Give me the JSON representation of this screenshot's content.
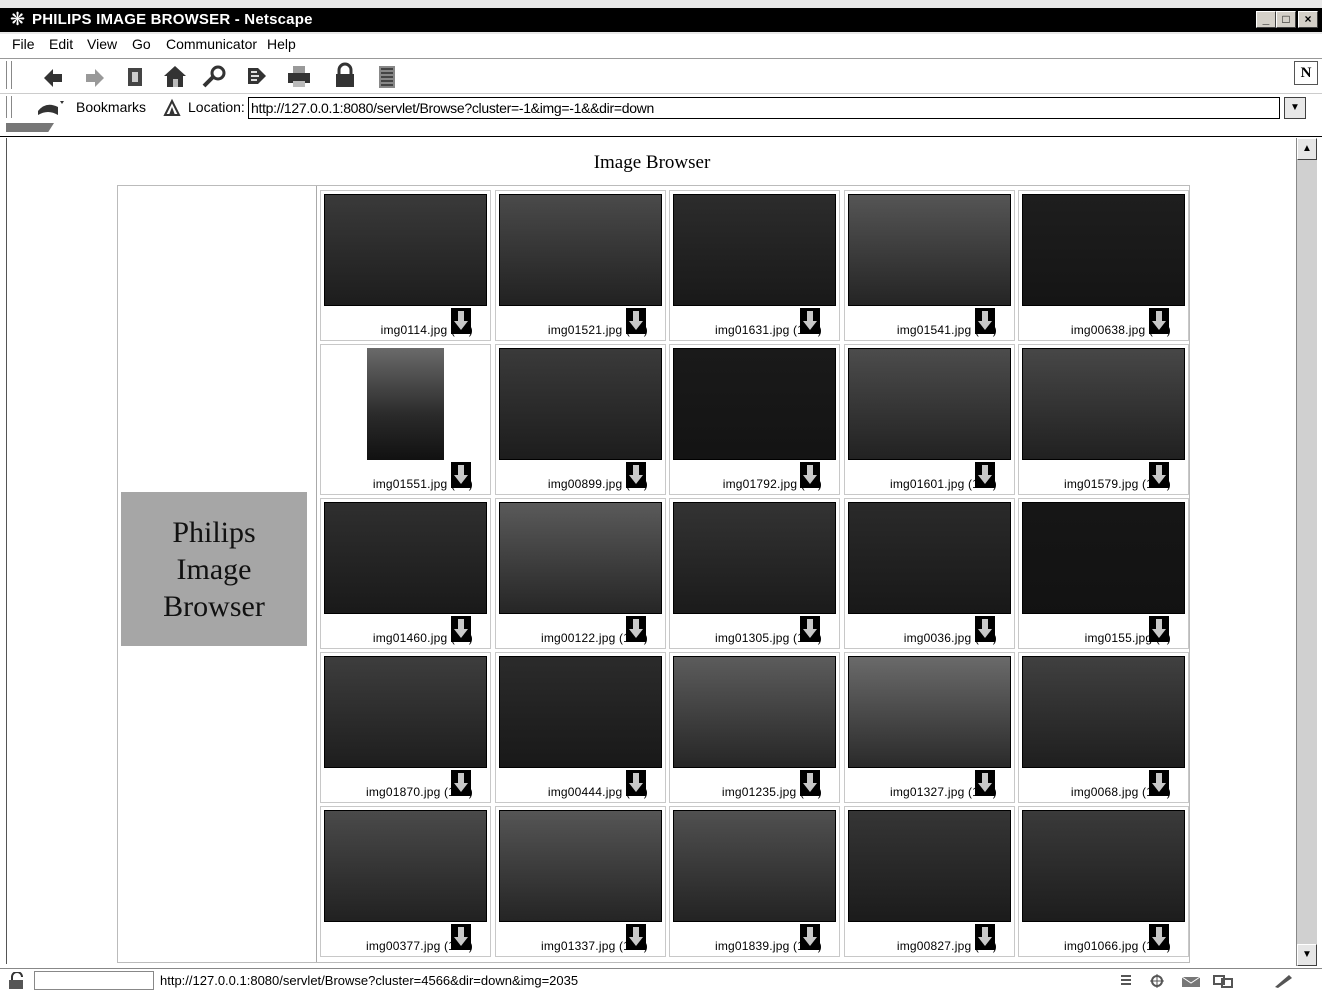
{
  "window": {
    "title": "PHILIPS IMAGE BROWSER - Netscape"
  },
  "menubar": {
    "items": [
      "File",
      "Edit",
      "View",
      "Go",
      "Communicator",
      "Help"
    ]
  },
  "toolbar": {
    "buttons": [
      "back-icon",
      "forward-icon",
      "reload-icon",
      "home-icon",
      "search-icon",
      "netscape-guide-icon",
      "print-icon",
      "security-icon",
      "stop-icon"
    ],
    "logo_text": "N"
  },
  "location": {
    "bookmarks_label": "Bookmarks",
    "location_label": "Location:",
    "url": "http://127.0.0.1:8080/servlet/Browse?cluster=-1&img=-1&&dir=down"
  },
  "page": {
    "heading": "Image Browser",
    "brand": "Philips\nImage\nBrowser",
    "images": [
      [
        "img0114.jpg (31)",
        "img01521.jpg (28)",
        "img01631.jpg (160)",
        "img01541.jpg (47)",
        "img00638.jpg (73)"
      ],
      [
        "img01551.jpg (24)",
        "img00899.jpg (93)",
        "img01792.jpg (11)",
        "img01601.jpg (106)",
        "img01579.jpg (186)"
      ],
      [
        "img01460.jpg (37)",
        "img00122.jpg (105)",
        "img01305.jpg (124)",
        "img0036.jpg (62)",
        "img0155.jpg (9)"
      ],
      [
        "img01870.jpg (183)",
        "img00444.jpg (26)",
        "img01235.jpg (28)",
        "img01327.jpg (162)",
        "img0068.jpg (168)"
      ],
      [
        "img00377.jpg (124)",
        "img01337.jpg (159)",
        "img01839.jpg (130)",
        "img00827.jpg (86)",
        "img01066.jpg (136)"
      ]
    ]
  },
  "statusbar": {
    "text": "http://127.0.0.1:8080/servlet/Browse?cluster=4566&dir=down&img=2035"
  }
}
